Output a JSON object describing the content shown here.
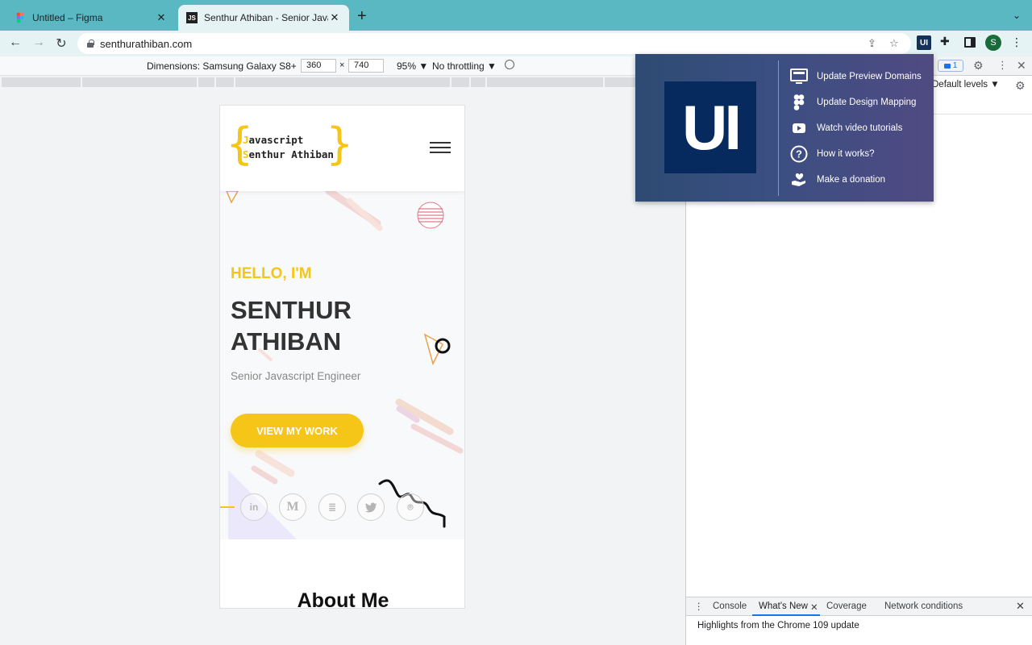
{
  "browser": {
    "tabs": [
      {
        "title": "Untitled – Figma",
        "active": false
      },
      {
        "title": "Senthur Athiban - Senior Javascript Engineer",
        "active": true
      }
    ],
    "new_tab_symbol": "+",
    "close_symbol": "✕",
    "tab_search_symbol": "⌄",
    "url": "senthurathiban.com",
    "profile_initial": "S",
    "extension_label": "UI"
  },
  "device_toolbar": {
    "dimensions_label": "Dimensions: Samsung Galaxy S8+ ▼",
    "width": "360",
    "height": "740",
    "multiply": "×",
    "zoom": "95% ▼",
    "throttling": "No throttling ▼"
  },
  "site": {
    "logo_line1_first": "J",
    "logo_line1_rest": "avascript",
    "logo_line2_first": "S",
    "logo_line2_rest": "enthur Athiban",
    "hero": {
      "greeting": "HELLO, I'M",
      "name": "SENTHUR ATHIBAN",
      "role": "Senior Javascript Engineer",
      "cta": "VIEW MY WORK"
    },
    "social": [
      {
        "icon": "linkedin-icon",
        "glyph": "in"
      },
      {
        "icon": "medium-icon",
        "glyph": "M"
      },
      {
        "icon": "stackoverflow-icon",
        "glyph": "≣"
      },
      {
        "icon": "twitter-icon",
        "glyph": "🐦"
      },
      {
        "icon": "github-icon",
        "glyph": "⌾"
      }
    ],
    "about_heading": "About Me"
  },
  "devtools": {
    "issues_count": "1",
    "levels": "Default levels ▼",
    "drawer_tabs": [
      "Console",
      "What's New",
      "Coverage",
      "Network conditions"
    ],
    "active_drawer_tab": "What's New",
    "drawer_message": "Highlights from the Chrome 109 update"
  },
  "extension_popup": {
    "logo": "UI",
    "items": [
      {
        "label": "Update Preview Domains",
        "icon": "monitor-icon"
      },
      {
        "label": "Update Design Mapping",
        "icon": "figma-icon"
      },
      {
        "label": "Watch video tutorials",
        "icon": "youtube-icon"
      },
      {
        "label": "How it works?",
        "icon": "question-icon"
      },
      {
        "label": "Make a donation",
        "icon": "donation-icon"
      }
    ]
  },
  "colors": {
    "tabstrip": "#5ab8c2",
    "accent_yellow": "#f5c518",
    "popup_left": "#2e4b73",
    "popup_right": "#4f4a82"
  }
}
